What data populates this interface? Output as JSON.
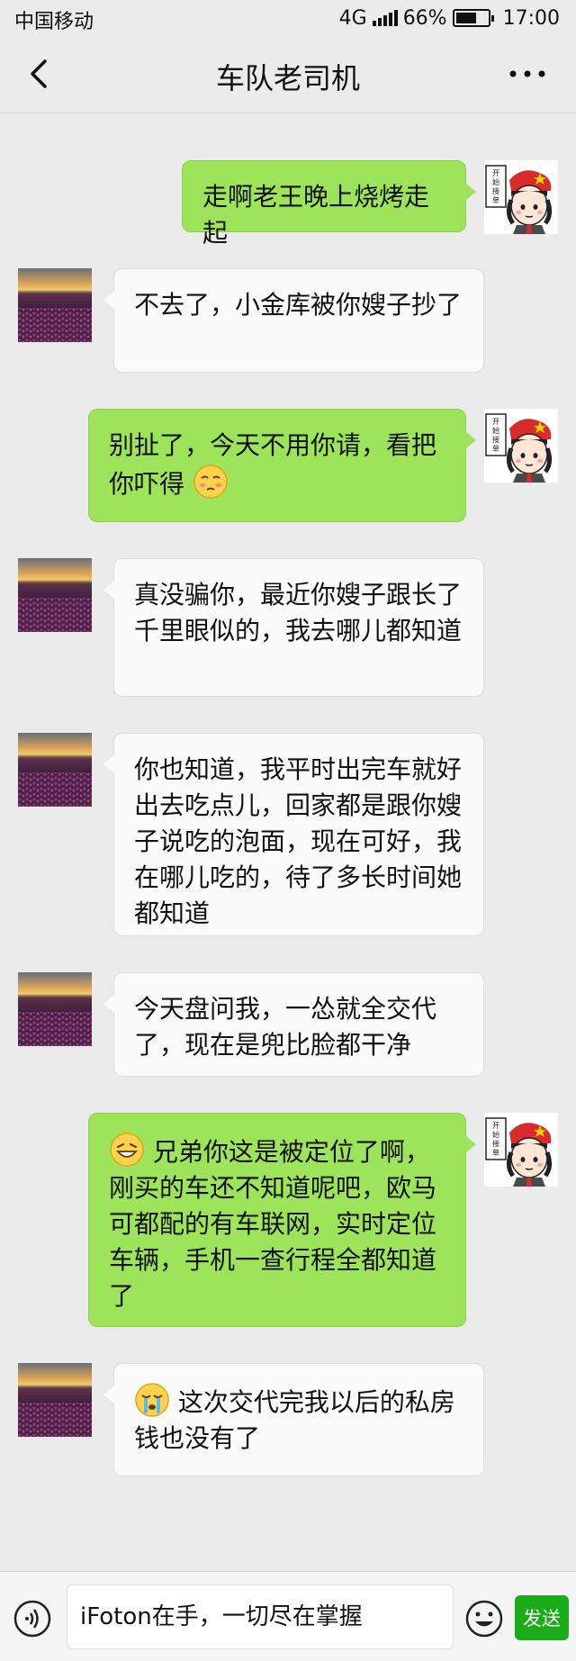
{
  "status_bar": {
    "carrier": "中国移动",
    "network": "4G",
    "battery": "66%",
    "battery_level": 0.66,
    "time": "17:00"
  },
  "nav": {
    "back_icon": "chevron-left-icon",
    "title": "车队老司机",
    "more_icon": "more-dots-icon"
  },
  "avatars": {
    "sender": "girl-sign-avatar",
    "contact": "sunset-field-avatar",
    "sign_text": "开始接单"
  },
  "messages": [
    {
      "from": "me",
      "text": "走啊老王晚上烧烤走起"
    },
    {
      "from": "them",
      "text": "不去了，小金库被你嫂子抄了"
    },
    {
      "from": "me",
      "text": "别扯了，今天不用你请，看把你吓得",
      "emoji_after": "smirk-emoji"
    },
    {
      "from": "them",
      "text": "真没骗你，最近你嫂子跟长了千里眼似的，我去哪儿都知道"
    },
    {
      "from": "them",
      "text": "你也知道，我平时出完车就好出去吃点儿，回家都是跟你嫂子说吃的泡面，现在可好，我在哪儿吃的，待了多长时间她都知道"
    },
    {
      "from": "them",
      "text": "今天盘问我，一怂就全交代了，现在是兜比脸都干净"
    },
    {
      "from": "me",
      "text": "兄弟你这是被定位了啊，刚买的车还不知道呢吧，欧马可都配的有车联网，实时定位车辆，手机一查行程全都知道了",
      "emoji_before": "grin-emoji"
    },
    {
      "from": "them",
      "text": "这次交代完我以后的私房钱也没有了",
      "emoji_before": "crying-emoji"
    }
  ],
  "input_bar": {
    "voice_icon": "voice-icon",
    "input_value": "iFoton在手，一切尽在掌握",
    "emoji_icon": "smiley-icon",
    "send_label": "发送"
  },
  "colors": {
    "background": "#ebebeb",
    "out_bubble": "#9ee45a",
    "in_bubble": "#fafafa",
    "send_button": "#1aad19"
  }
}
